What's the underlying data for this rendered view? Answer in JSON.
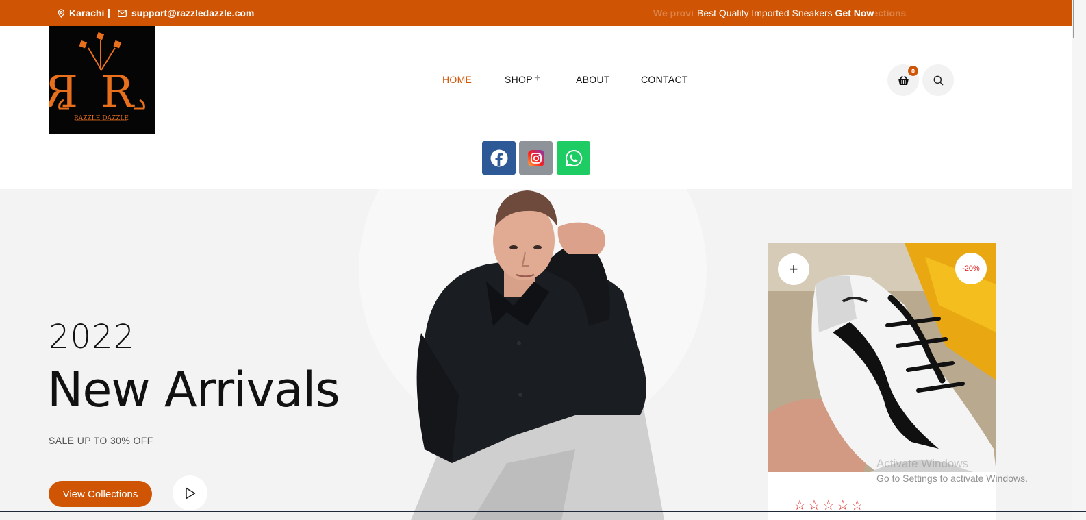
{
  "topbar": {
    "location": "Karachi",
    "separator": "|",
    "email": "support@razzledazzle.com",
    "ticker_ghost_left": "We provi",
    "ticker_ghost_right": "ollections",
    "ticker_text": "Best Quality Imported Sneakers",
    "ticker_cta": "Get Now"
  },
  "logo": {
    "brand": "RAZZLE DAZZLE"
  },
  "nav": {
    "home": "HOME",
    "shop": "SHOP",
    "shop_expand": "+",
    "about": "ABOUT",
    "contact": "CONTACT"
  },
  "cart": {
    "count": "0",
    "icon": "basket-icon"
  },
  "search": {
    "icon": "search-icon"
  },
  "social": {
    "facebook": "facebook-icon",
    "instagram": "instagram-icon",
    "whatsapp": "whatsapp-icon"
  },
  "hero": {
    "year": "2022",
    "title": "New Arrivals",
    "subtitle": "SALE UP TO 30% OFF",
    "cta": "View Collections"
  },
  "product_card": {
    "discount": "-20%",
    "add": "+",
    "rating_stars": 0,
    "rating_max": 5
  },
  "os_watermark": {
    "line1": "Activate Windows",
    "line2": "Go to Settings to activate Windows."
  },
  "colors": {
    "accent": "#cf5504",
    "facebook": "#2d5a96",
    "whatsapp": "#1dcc63",
    "sale": "#e02424"
  }
}
